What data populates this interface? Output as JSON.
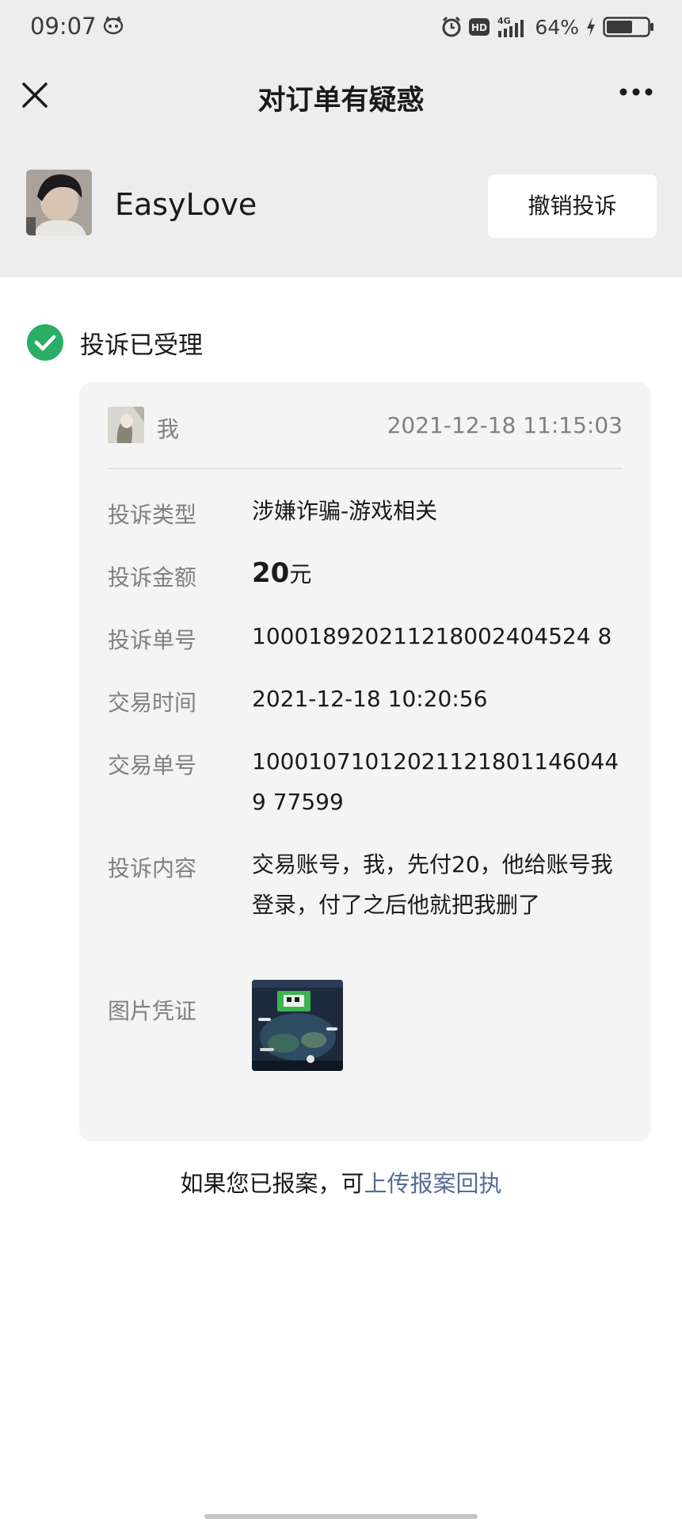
{
  "status_bar": {
    "time": "09:07",
    "network": "4G",
    "battery_percent": "64%",
    "battery_level": 0.64
  },
  "navbar": {
    "title": "对订单有疑惑",
    "close_icon": "close-icon",
    "more_icon": "more-icon"
  },
  "merchant": {
    "name": "EasyLove",
    "revoke_label": "撤销投诉"
  },
  "status": {
    "text": "投诉已受理",
    "color": "#2aae67"
  },
  "complaint": {
    "user_label": "我",
    "submitted_time": "2021-12-18 11:15:03",
    "rows": {
      "type": {
        "label": "投诉类型",
        "value": "涉嫌诈骗-游戏相关"
      },
      "amount": {
        "label": "投诉金额",
        "number": "20",
        "unit": "元"
      },
      "complaint_no": {
        "label": "投诉单号",
        "value": "100018920211218002404524 8"
      },
      "trade_time": {
        "label": "交易时间",
        "value": "2021-12-18 10:20:56"
      },
      "trade_no": {
        "label": "交易单号",
        "value": "100010710120211218011460449 77599"
      },
      "content": {
        "label": "投诉内容",
        "value": "交易账号，我，先付20，他给账号我登录，付了之后他就把我删了"
      },
      "evidence": {
        "label": "图片凭证"
      }
    }
  },
  "footer": {
    "prefix": "如果您已报案，可",
    "link": "上传报案回执",
    "link_color": "#576b95"
  }
}
